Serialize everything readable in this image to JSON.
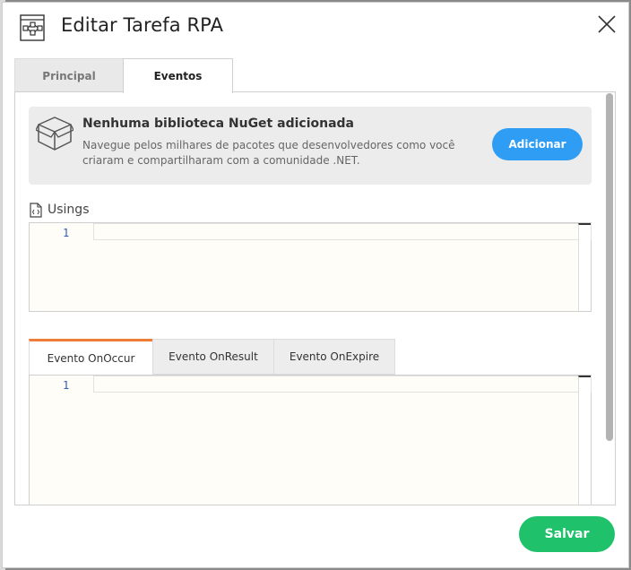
{
  "dialog": {
    "title": "Editar Tarefa RPA",
    "icon": "workflow-icon",
    "close_icon": "close-icon"
  },
  "tabs": [
    {
      "label": "Principal",
      "active": false
    },
    {
      "label": "Eventos",
      "active": true
    }
  ],
  "nuget": {
    "icon": "package-box-icon",
    "title": "Nenhuma biblioteca NuGet adicionada",
    "description": "Navegue pelos milhares de pacotes que desenvolvedores como você criaram e compartilharam com a comunidade .NET.",
    "add_label": "Adicionar"
  },
  "usings": {
    "icon": "code-file-icon",
    "label": "Usings",
    "line_number": "1"
  },
  "event_tabs": [
    {
      "label": "Evento OnOccur",
      "active": true
    },
    {
      "label": "Evento OnResult",
      "active": false
    },
    {
      "label": "Evento OnExpire",
      "active": false
    }
  ],
  "event_editor": {
    "line_number": "1"
  },
  "footer": {
    "save_label": "Salvar"
  },
  "colors": {
    "primary_blue": "#2f9df4",
    "save_green": "#1fc26b",
    "active_tab_accent": "#f07c3a"
  }
}
